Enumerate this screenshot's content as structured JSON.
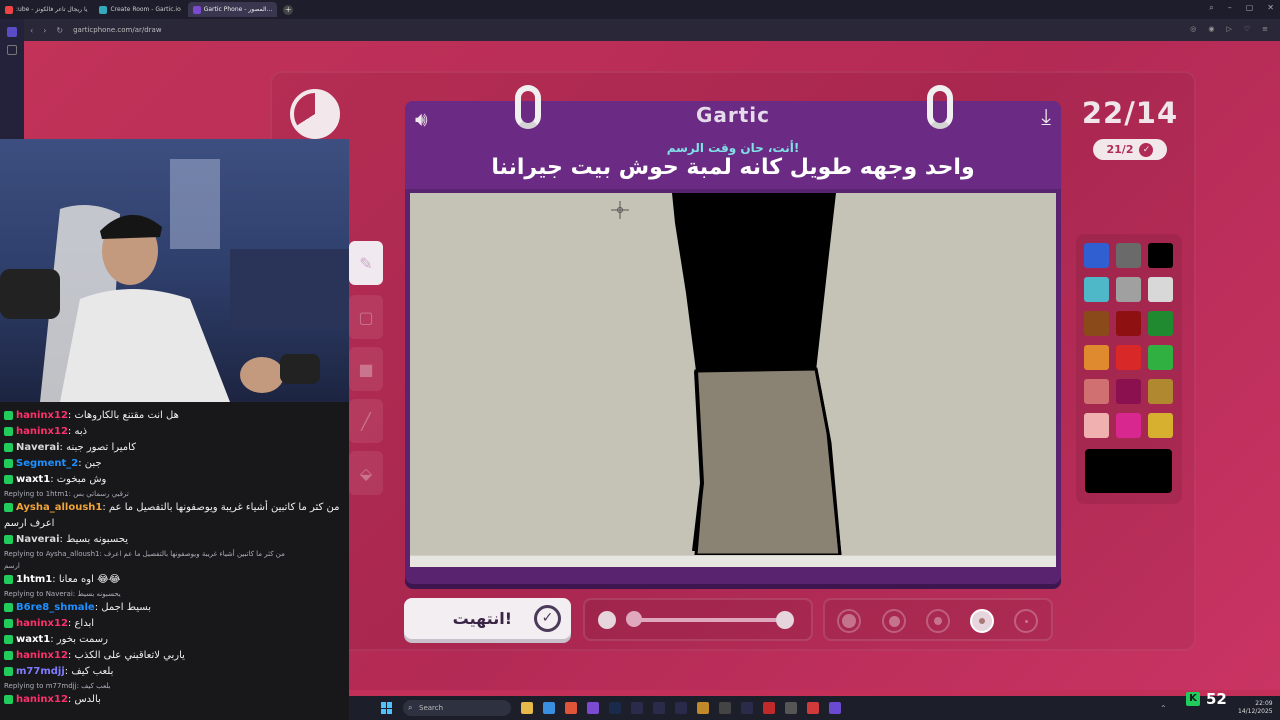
{
  "browser": {
    "tabs": [
      {
        "label": ":ube - يا ريجال تاعر فالكونز"
      },
      {
        "label": "Create Room - Gartic.io"
      },
      {
        "label": "Gartic Phone - المصور...",
        "active": true
      }
    ],
    "url": "garticphone.com/ar/draw",
    "add_tab": "+"
  },
  "game": {
    "logo": "Gartic",
    "subtitle": "أنت، حان وقت الرسم!",
    "prompt": "واحد وجهه طويل كانه لمبة حوش بيت جيراننا",
    "round": "22/14",
    "done_count": "21/2",
    "done_button": "انتهيت!",
    "palette": [
      "#2f5fd0",
      "#6a6a6a",
      "#000000",
      "#4fb8c8",
      "#a0a0a0",
      "#d8d8d8",
      "#8a4a1a",
      "#8f1010",
      "#1f8a30",
      "#e08a30",
      "#d82828",
      "#30b040",
      "#d07070",
      "#8a1050",
      "#b08830",
      "#f0b0b0",
      "#d82890",
      "#d8b030"
    ],
    "current_color": "#000000",
    "opacity": 0.98,
    "sizes_selected_index": 3
  },
  "chat": {
    "messages": [
      {
        "user": "haninx12",
        "cls": "u1",
        "text": "هل انت مقتنع بالكاروهات"
      },
      {
        "user": "haninx12",
        "cls": "u1",
        "text": "ذبه"
      },
      {
        "user": "Naverai",
        "cls": "u2",
        "text": "كاميرا تصور جبنه"
      },
      {
        "user": "Segment_2",
        "cls": "u3",
        "text": "جبن"
      },
      {
        "user": "waxt1",
        "cls": "u4",
        "text": "وش مبخوت"
      },
      {
        "reply": true,
        "text": "Replying to 1htm1: ترقبي رسماتي بس"
      },
      {
        "user": "Aysha_alloush1",
        "cls": "u5",
        "text": "من كثر ما كاتبين أشياء غريبة ويوصفونها بالتفصيل ما عم"
      },
      {
        "cont": true,
        "text": "اعرف ارسم"
      },
      {
        "user": "Naverai",
        "cls": "u2",
        "text": "يحسبونه بسيط"
      },
      {
        "reply": true,
        "text": "Replying to Aysha_alloush1: من كثر ما كاتبين أشياء غريبة ويوصفونها بالتفصيل ما عم اعرف"
      },
      {
        "reply": true,
        "text": "ارسم"
      },
      {
        "user": "1htm1",
        "cls": "u4",
        "text": "اوه معانا 😂😂"
      },
      {
        "reply": true,
        "text": "Replying to Naverai: يحسبونه بسيط"
      },
      {
        "user": "B6re8_shmale",
        "cls": "u3",
        "text": "بسيط اجمل"
      },
      {
        "user": "haninx12",
        "cls": "u1",
        "text": "ابداع"
      },
      {
        "user": "waxt1",
        "cls": "u4",
        "text": "رسمت بخور"
      },
      {
        "user": "haninx12",
        "cls": "u1",
        "text": "ياربي لاتعاقبني على الكذب"
      },
      {
        "user": "m77mdjj",
        "cls": "u6",
        "text": "بلعب كيف"
      },
      {
        "reply": true,
        "text": "Replying to m77mdjj: بلعب كيف"
      },
      {
        "user": "haninx12",
        "cls": "u1",
        "text": "بالدس"
      }
    ]
  },
  "taskbar": {
    "search_placeholder": "Search",
    "viewers": "52",
    "time": "22:09",
    "date": "14/12/2025"
  }
}
